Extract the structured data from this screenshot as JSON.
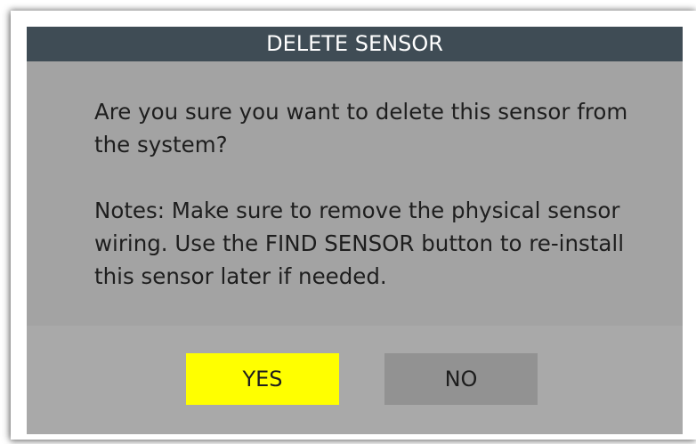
{
  "dialog": {
    "title": "DELETE SENSOR",
    "question": "Are you sure you want to delete this sensor from the system?",
    "notes": "Notes: Make sure to remove the physical sensor wiring. Use the FIND SENSOR button to re-install this sensor later if needed.",
    "yes_label": "YES",
    "no_label": "NO"
  },
  "colors": {
    "title_bar": "#3f4c55",
    "dialog_background": "#a5a5a5",
    "yes_button": "#ffff00",
    "no_button": "#929292"
  }
}
